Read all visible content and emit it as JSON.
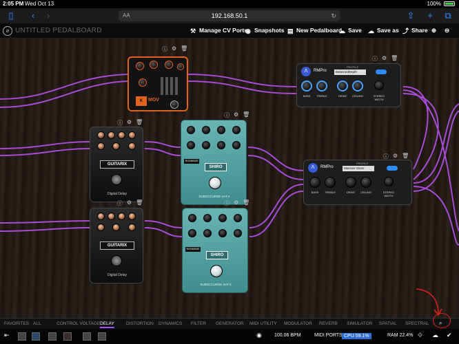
{
  "status_bar": {
    "time": "2:05 PM",
    "date": "Wed Oct 13",
    "battery": "100%"
  },
  "browser": {
    "url": "192.168.50.1",
    "aa": "AA"
  },
  "header": {
    "title": "UNTITLED PEDALBOARD",
    "buttons": [
      "Manage CV Ports",
      "Snapshots",
      "New Pedalboard",
      "Save",
      "Save as",
      "Share"
    ]
  },
  "pedals": {
    "rmpro_top": {
      "name": "RMPro",
      "profile_label": "PROFILE",
      "profile": "BalancedDepth",
      "knobs": [
        "BASS",
        "TREBLE",
        "DRIVE",
        "CEILING",
        "STEREO WIDTH"
      ]
    },
    "rmpro_mid": {
      "name": "RMPro",
      "profile_label": "PROFILE",
      "profile": "Massive Stone",
      "knobs": [
        "BASS",
        "TREBLE",
        "DRIVE",
        "CEILING",
        "STEREO WIDTH"
      ]
    },
    "guitarix_1": {
      "brand": "GUITARIX",
      "name": "Digital Delay"
    },
    "guitarix_2": {
      "brand": "GUITARIX",
      "name": "Digital Delay"
    },
    "shiro_1": {
      "brand": "SHIRO",
      "name": "SUBOCCURSE SAT II",
      "btn": "ROOMSIZE"
    },
    "shiro_2": {
      "brand": "SHIRO",
      "name": "SUBOCCURSE SAT II",
      "btn": "ROOMSIZE"
    },
    "kmov": {
      "brand": "MOV"
    }
  },
  "categories": [
    "FAVORITES",
    "ALL",
    "CONTROL VOLTAGE",
    "DELAY",
    "DISTORTION",
    "DYNAMICS",
    "FILTER",
    "GENERATOR",
    "MIDI UTILITY",
    "MODULATOR",
    "REVERB",
    "SIMULATOR",
    "SPATIAL",
    "SPECTRAL"
  ],
  "active_category": "DELAY",
  "bottom": {
    "bpm": "100.06 BPM",
    "midi": "MIDI PORTS",
    "cpu": "CPU 59.1%",
    "ram": "RAM 22.4%"
  }
}
